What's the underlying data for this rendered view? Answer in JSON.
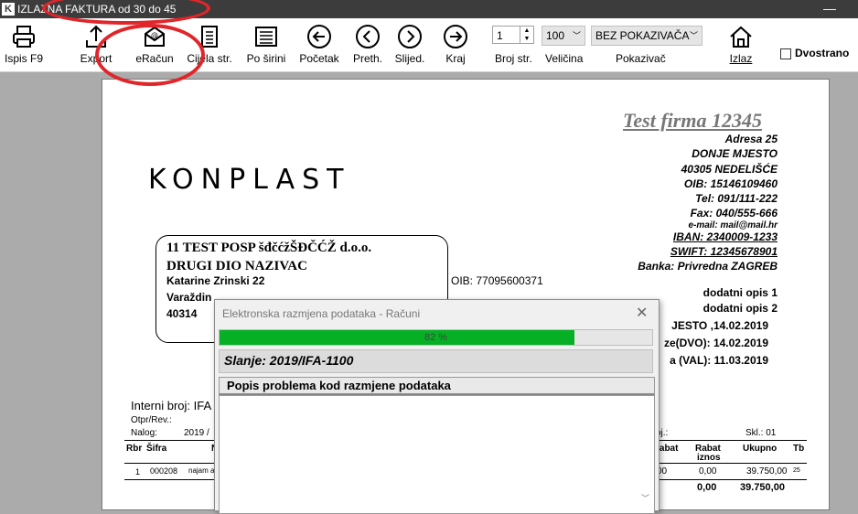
{
  "window": {
    "title": "IZLAZNA FAKTURA od 30 do 45",
    "app_icon": "K",
    "minimize": "—"
  },
  "toolbar": {
    "print_label": "Ispis  F9",
    "export_label": "Export",
    "eracun_label": "eRačun",
    "whole_page_label": "Cijela str.",
    "width_label": "Po širini",
    "start_label": "Početak",
    "prev_label": "Preth.",
    "next_label": "Slijed.",
    "end_label": "Kraj",
    "page_no_value": "1",
    "page_no_label": "Broj str.",
    "zoom_value": "100",
    "zoom_label": "Veličina",
    "pointer_value": "BEZ POKAZIVAČA",
    "pointer_label": "Pokazivač",
    "exit_label": "Izlaz",
    "duplex_label": "Dvostrano"
  },
  "invoice": {
    "company_name": "Test firma 12345",
    "address": "Adresa 25",
    "place": "DONJE MJESTO",
    "city": "40305 NEDELIŠĆE",
    "oib": "OIB: 15146109460",
    "tel": "Tel: 091/111-222",
    "fax": "Fax: 040/555-666",
    "email": "e-mail: mail@mail.hr",
    "iban": "IBAN: 2340009-1233",
    "swift": "SWIFT: 12345678901",
    "bank": "Banka: Privredna ZAGREB",
    "logo": "KONPLAST",
    "customer": {
      "line1": "11 TEST POSP šđčćžŠĐČĆŽ d.o.o.",
      "line2": "DRUGI DIO NAZIVAC",
      "street": "Katarine Zrinski 22",
      "city": "Varaždin",
      "zip": "40314",
      "oib": "OIB: 77095600371"
    },
    "extra1": "dodatni opis 1",
    "extra2": "dodatni opis 2",
    "place_date": "JESTO  ,14.02.2019",
    "dvo": "ze(DVO): 14.02.2019",
    "val": "a (VAL): 11.03.2019",
    "internal_no": "Interni broj:  IFA",
    "otpr": "Otpr/Rev.:",
    "nalog": "Nalog:",
    "nalog_val": "2019 /",
    "skl_prefix": "oj.:",
    "skl": "Skl.: 01",
    "columns": {
      "rbr": "Rbr",
      "sifra": "Šifra",
      "m": "N",
      "rabat": "rabat",
      "rabat_iznos_1": "Rabat",
      "rabat_iznos_2": "iznos",
      "ukupno": "Ukupno",
      "tb": "Tb"
    },
    "row": {
      "rbr": "1",
      "sifra": "000208",
      "naziv": "najam a",
      "rabat": "00",
      "rabat_iznos": "0,00",
      "ukupno": "39.750,00",
      "tb": "25"
    },
    "totals": {
      "rabat_iznos": "0,00",
      "ukupno": "39.750,00"
    }
  },
  "dialog": {
    "title": "Elektronska razmjena podataka - Računi",
    "close": "✕",
    "progress": 82,
    "progress_text": "82 %",
    "status": "Slanje: 2019/IFA-1100",
    "problems_header": "Popis problema kod razmjene podataka"
  },
  "colors": {
    "annotation": "#e0262a",
    "progress": "#06b025",
    "titlebar": "#3c3c3c"
  },
  "icons": [
    "printer-icon",
    "export-icon",
    "email-icon",
    "whole-page-icon",
    "page-width-icon",
    "arrow-left-icon",
    "chevron-left-icon",
    "chevron-right-icon",
    "arrow-right-icon",
    "home-icon"
  ]
}
